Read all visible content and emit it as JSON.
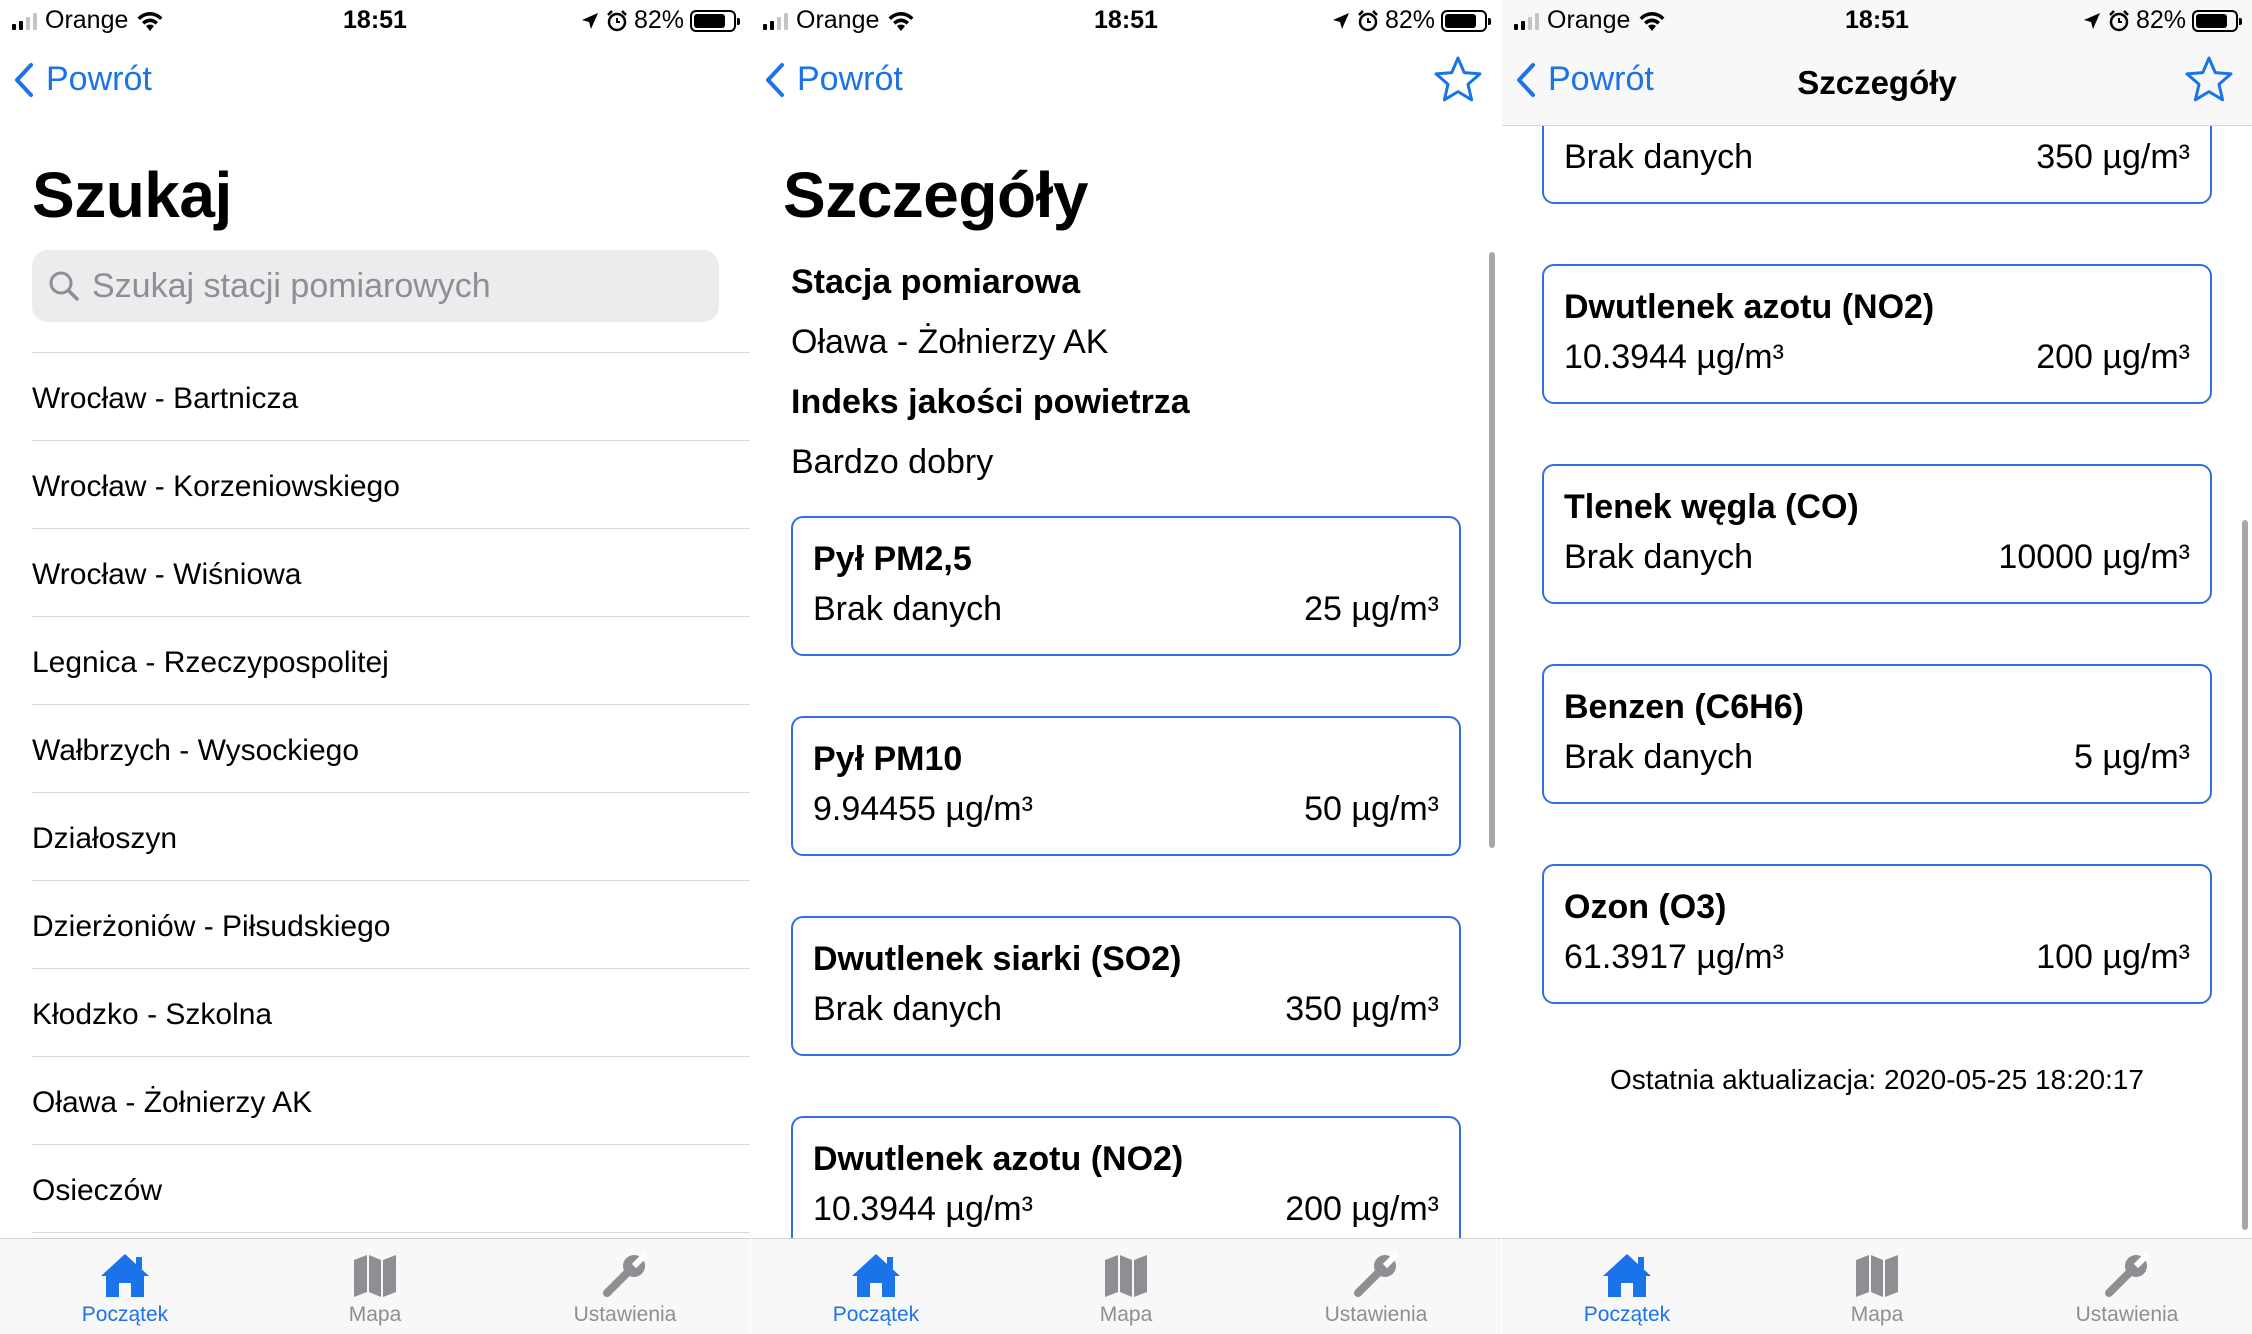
{
  "status": {
    "carrier": "Orange",
    "time": "18:51",
    "battery": "82%",
    "battery_level": 0.82
  },
  "nav": {
    "back_label": "Powrót",
    "details_title": "Szczegóły"
  },
  "search_screen": {
    "title": "Szukaj",
    "search_placeholder": "Szukaj stacji pomiarowych",
    "stations": [
      "Wrocław - Bartnicza",
      "Wrocław - Korzeniowskiego",
      "Wrocław - Wiśniowa",
      "Legnica - Rzeczypospolitej",
      "Wałbrzych - Wysockiego",
      "Działoszyn",
      "Dzierżoniów - Piłsudskiego",
      "Kłodzko - Szkolna",
      "Oława - Żołnierzy AK",
      "Osieczów"
    ]
  },
  "details_screen": {
    "title": "Szczegóły",
    "station_label": "Stacja pomiarowa",
    "station_value": "Oława - Żołnierzy AK",
    "index_label": "Indeks jakości powietrza",
    "index_value": "Bardzo dobry",
    "measurements": [
      {
        "name": "Pył PM2,5",
        "value": "Brak danych",
        "norm": "25 µg/m³"
      },
      {
        "name": "Pył PM10",
        "value": "9.94455 µg/m³",
        "norm": "50 µg/m³"
      },
      {
        "name": "Dwutlenek siarki (SO2)",
        "value": "Brak danych",
        "norm": "350 µg/m³"
      },
      {
        "name": "Dwutlenek azotu (NO2)",
        "value": "10.3944 µg/m³",
        "norm": "200 µg/m³"
      },
      {
        "name": "Tlenek węgla (CO)",
        "value": "Brak danych",
        "norm": "10000 µg/m³"
      },
      {
        "name": "Benzen (C6H6)",
        "value": "Brak danych",
        "norm": "5 µg/m³"
      },
      {
        "name": "Ozon (O3)",
        "value": "61.3917 µg/m³",
        "norm": "100 µg/m³"
      }
    ],
    "last_update": "Ostatnia aktualizacja: 2020-05-25 18:20:17"
  },
  "tabs": [
    {
      "label": "Początek",
      "icon": "house-icon"
    },
    {
      "label": "Mapa",
      "icon": "map-icon"
    },
    {
      "label": "Ustawienia",
      "icon": "wrench-icon"
    }
  ],
  "colors": {
    "accent": "#1a73e8",
    "card_border": "#2f6fe0",
    "inactive": "#8e8e93"
  }
}
